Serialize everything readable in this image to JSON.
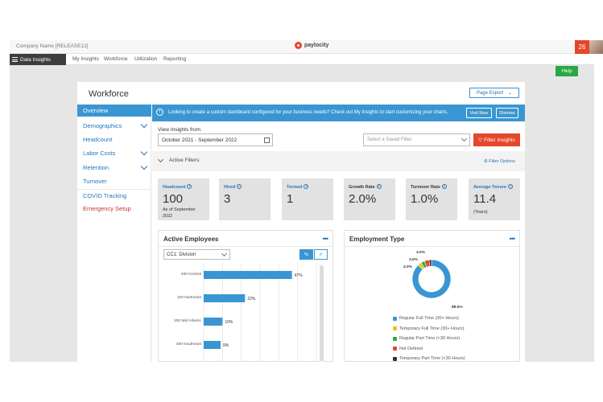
{
  "topbar": {
    "company": "Company Name [RELEASE12]",
    "logo": "paylocity",
    "notif_count": "26"
  },
  "nav": {
    "data_insights": "Data Insights",
    "links": [
      "My Insights",
      "Workforce",
      "Utilization",
      "Reporting"
    ]
  },
  "help_label": "Help",
  "page": {
    "title": "Workforce",
    "page_export": "Page Export"
  },
  "sidebar": {
    "items": [
      {
        "label": "Overview",
        "active": true
      },
      {
        "label": "Demographics",
        "chevron": true
      },
      {
        "label": "Headcount"
      },
      {
        "label": "Labor Costs",
        "chevron": true
      },
      {
        "label": "Retention",
        "chevron": true
      },
      {
        "label": "Turnover"
      },
      {
        "label": "COVID Tracking"
      },
      {
        "label": "Emergency Setup"
      }
    ]
  },
  "banner": {
    "text": "Looking to create a custom dashboard configured for your business needs? Check out My Insights to start customizing your charts.",
    "visit_now": "Visit Now",
    "dismiss": "Dismiss"
  },
  "insights": {
    "view_label": "View Insights from",
    "date_range": "October 2021 - September 2022",
    "saved_filter_placeholder": "Select a Saved Filter",
    "filter_button": "Filter Insights",
    "active_filters": "Active Filters:",
    "filter_options": "Filter Options"
  },
  "kpis": [
    {
      "label": "Headcount",
      "value": "100",
      "sub": "As of September 2022",
      "link": true
    },
    {
      "label": "Hired",
      "value": "3",
      "link": true
    },
    {
      "label": "Termed",
      "value": "1",
      "link": true
    },
    {
      "label": "Growth Rate",
      "value": "2.0%",
      "link": false
    },
    {
      "label": "Turnover Rate",
      "value": "1.0%",
      "link": false
    },
    {
      "label": "Average Tenure",
      "value": "11.4",
      "sub": "(Years)",
      "link": true
    }
  ],
  "active_employees": {
    "title": "Active Employees",
    "dimension": "CC1: Division",
    "toggle_percent": "%",
    "toggle_count": "#"
  },
  "employment_type": {
    "title": "Employment Type",
    "legend": [
      {
        "label": "Regular Full Time (30+ Hours)",
        "color": "#3a96d2"
      },
      {
        "label": "Temporary Full Time (30+ Hours)",
        "color": "#f2c200"
      },
      {
        "label": "Regular Part Time (<30 Hours)",
        "color": "#2ea84a"
      },
      {
        "label": "Not Defined",
        "color": "#e4472a"
      },
      {
        "label": "Temporary Part Time (<30 Hours)",
        "color": "#333333"
      }
    ]
  },
  "chart_data": [
    {
      "type": "bar",
      "orientation": "horizontal",
      "categories": [
        "400-Central",
        "100 Northeast",
        "200 Mid Atlantic",
        "300-Southeast"
      ],
      "values": [
        47,
        22,
        10,
        9
      ],
      "value_labels": [
        "47%",
        "22%",
        "10%",
        "9%"
      ],
      "xlim": [
        0,
        60
      ],
      "color": "#3a96d2",
      "grid": true
    },
    {
      "type": "pie",
      "donut": true,
      "labels": [
        "Regular Full Time (30+ Hours)",
        "Temporary Full Time (30+ Hours)",
        "Regular Part Time (<30 Hours)",
        "Not Defined",
        "Temporary Part Time (<30 Hours)"
      ],
      "values": [
        88.0,
        3.0,
        3.0,
        4.0,
        2.0
      ],
      "value_labels": [
        "88.0%",
        "3.0%",
        "3.0%",
        "4.0%",
        ""
      ],
      "colors": [
        "#3a96d2",
        "#f2c200",
        "#2ea84a",
        "#e4472a",
        "#333333"
      ]
    }
  ]
}
